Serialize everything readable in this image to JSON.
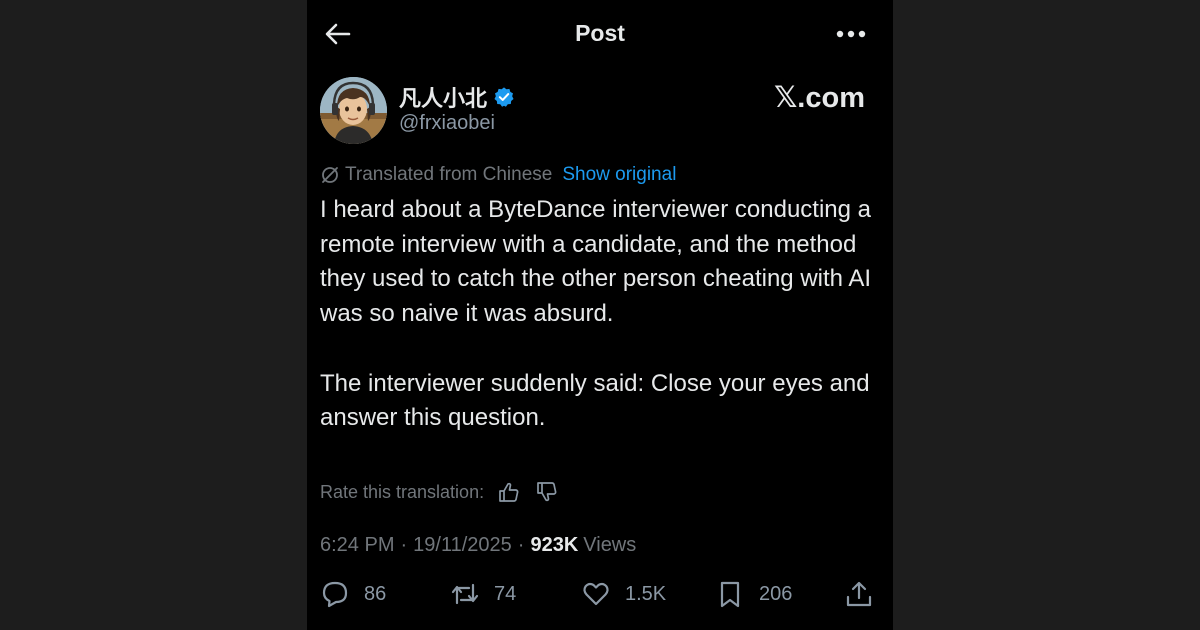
{
  "header": {
    "title": "Post",
    "back_icon": "arrow-left-icon",
    "more_icon": "more-horizontal-icon"
  },
  "author": {
    "display_name": "凡人小北",
    "handle": "@frxiaobei",
    "verified": true,
    "verified_color": "#1d9bf0"
  },
  "watermark": "𝕏.com",
  "translation": {
    "label": "Translated from Chinese",
    "show_original": "Show original",
    "rate_label": "Rate this translation:"
  },
  "post": {
    "paragraphs": [
      "I heard about a ByteDance interviewer conducting a remote interview with a candidate, and the method they used to catch the other person cheating with AI was so naive it was absurd.",
      "The interviewer suddenly said: Close your eyes and answer this question."
    ],
    "time": "6:24 PM",
    "date": "19/11/2025",
    "views_count": "923K",
    "views_label": "Views",
    "separator": "·"
  },
  "actions": {
    "replies": "86",
    "reposts": "74",
    "likes": "1.5K",
    "bookmarks": "206"
  },
  "colors": {
    "background": "#000000",
    "outer_background": "#1d1d1d",
    "text": "#e7e9ea",
    "muted": "#71767b",
    "accent": "#1d9bf0"
  }
}
